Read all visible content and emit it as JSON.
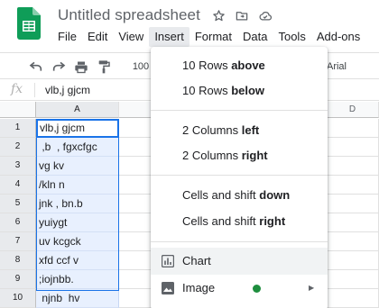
{
  "app": {
    "title": "Untitled spreadsheet",
    "colors": {
      "sheets_green": "#0f9d58",
      "selection_blue": "#1a73e8",
      "selection_fill": "#e8f0fe",
      "new_badge": "#1e8e3e"
    }
  },
  "title_icons": [
    "star-icon",
    "move-to-folder-icon",
    "cloud-status-icon"
  ],
  "menubar": [
    "File",
    "Edit",
    "View",
    "Insert",
    "Format",
    "Data",
    "Tools",
    "Add-ons"
  ],
  "toolbar": {
    "zoom": "100",
    "font": "Arial"
  },
  "formula_bar": {
    "fx": "fx",
    "value": "vlb,j gjcm"
  },
  "grid": {
    "columns": [
      "A",
      "D"
    ],
    "rows": [
      "1",
      "2",
      "3",
      "4",
      "5",
      "6",
      "7",
      "8",
      "9",
      "10"
    ],
    "col_a_values": [
      "vlb,j gjcm",
      " ,b  , fgxcfgc",
      "vg kv",
      "/kln n",
      "jnk , bn.b",
      "yuiygt",
      "uv kcgck",
      "xfd ccf v",
      ";iojnbb.",
      " njnb  hv"
    ]
  },
  "insert_menu": {
    "rows_above": {
      "pre": "10 Rows ",
      "bold": "above"
    },
    "rows_below": {
      "pre": "10 Rows ",
      "bold": "below"
    },
    "cols_left": {
      "pre": "2 Columns ",
      "bold": "left"
    },
    "cols_right": {
      "pre": "2 Columns ",
      "bold": "right"
    },
    "cells_down": {
      "pre": "Cells and shift ",
      "bold": "down"
    },
    "cells_right": {
      "pre": "Cells and shift ",
      "bold": "right"
    },
    "chart": "Chart",
    "image": "Image"
  }
}
